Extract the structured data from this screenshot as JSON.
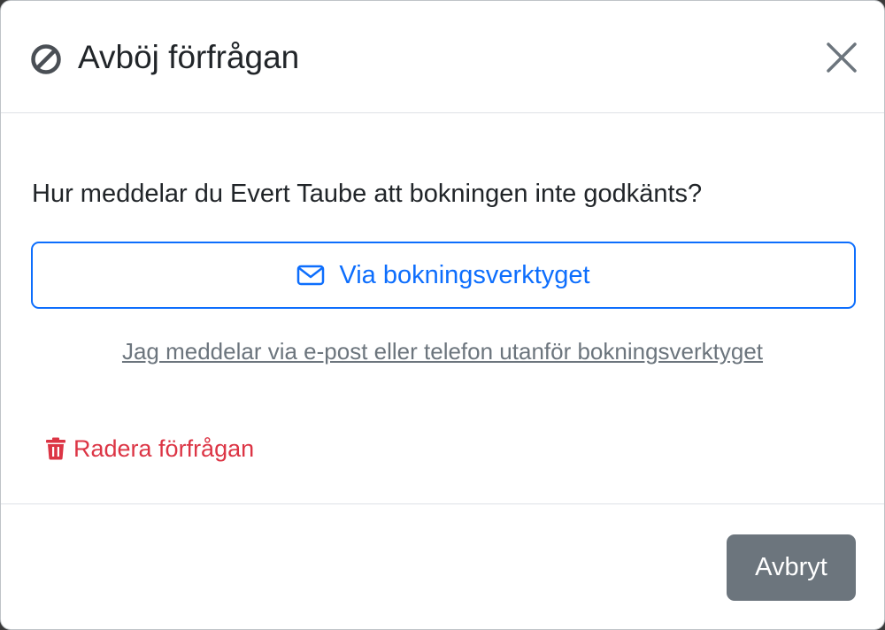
{
  "dialog": {
    "title": "Avböj förfrågan",
    "title_icon": "ban-icon",
    "close_icon": "close-icon"
  },
  "body": {
    "question": "Hur meddelar du Evert Taube att bokningen inte godkänts?",
    "primary_option": {
      "label": "Via bokningsverktyget",
      "icon": "envelope-icon"
    },
    "secondary_option": {
      "label": "Jag meddelar via e-post eller telefon utanför bokningsverktyget"
    },
    "delete_action": {
      "label": "Radera förfrågan",
      "icon": "trash-icon"
    }
  },
  "footer": {
    "cancel_label": "Avbryt"
  },
  "colors": {
    "primary": "#0d6efd",
    "danger": "#dc3545",
    "secondary": "#6c757d",
    "text": "#212529"
  }
}
